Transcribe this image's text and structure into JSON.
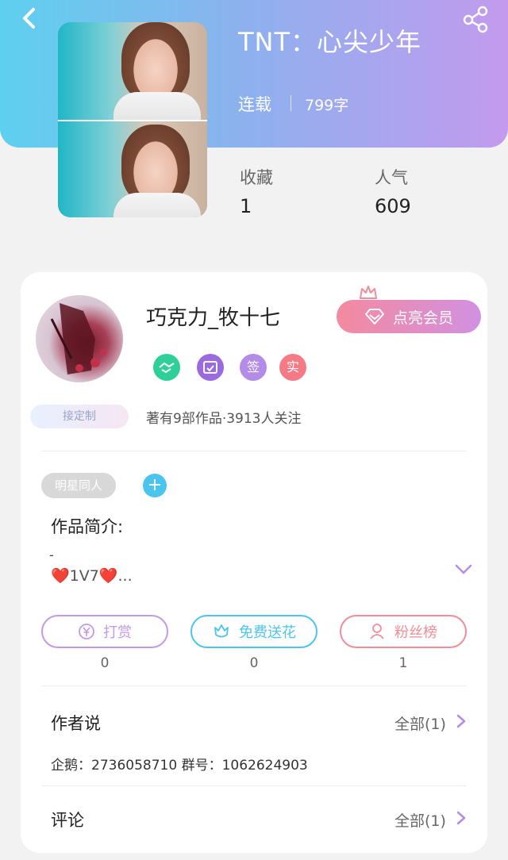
{
  "book": {
    "title": "TNT：心尖少年",
    "status": "连载",
    "word_count": "799字",
    "stats": [
      {
        "label": "收藏",
        "value": "1"
      },
      {
        "label": "人气",
        "value": "609"
      }
    ]
  },
  "author": {
    "name": "巧克力_牧十七",
    "vip_label": "点亮会员",
    "custom_badge": "接定制",
    "tags": [
      {
        "icon": "handshake-icon",
        "color": "#2ecf98"
      },
      {
        "icon": "calendar-icon",
        "color": "#9b6adf"
      },
      {
        "label": "签",
        "color": "#b58be8"
      },
      {
        "label": "实",
        "color": "#f47b86"
      }
    ],
    "stats_text": "著有9部作品·3913人关注"
  },
  "genre": {
    "tag": "明星同人",
    "add_label": "+"
  },
  "intro": {
    "heading": "作品简介:",
    "line1": "-",
    "line2": "❤️1V7❤️..."
  },
  "actions": [
    {
      "label": "打赏",
      "icon": "yen-icon",
      "count": "0",
      "color": "#c499e8"
    },
    {
      "label": "免费送花",
      "icon": "flower-icon",
      "count": "0",
      "color": "#4cc5ee"
    },
    {
      "label": "粉丝榜",
      "icon": "user-icon",
      "count": "1",
      "color": "#f08d98"
    }
  ],
  "author_says": {
    "heading": "作者说",
    "more": "全部(1)",
    "text": "企鹅：2736058710 群号：1062624903"
  },
  "comments": {
    "heading": "评论",
    "more": "全部(1)"
  },
  "colors": {
    "header_gradient": [
      "#5ed0ef",
      "#c39aee"
    ],
    "accent_purple": "#b58be8",
    "vip_gradient": [
      "#f48aa0",
      "#d191e0"
    ]
  }
}
